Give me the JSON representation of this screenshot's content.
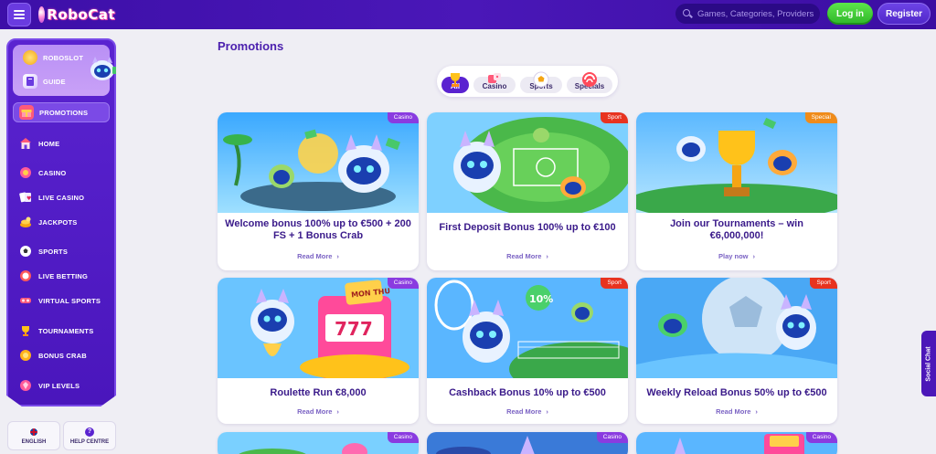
{
  "header": {
    "brand": "RoboCat",
    "search_placeholder": "Games, Categories, Providers",
    "login_label": "Log in",
    "register_label": "Register",
    "colors": {
      "header_bg": "#4a17b8",
      "login": "#3fc935",
      "register": "#5a2fd6"
    }
  },
  "sidebar": {
    "promo_items": [
      {
        "label": "ROBOSLOT",
        "icon": "coin-icon"
      },
      {
        "label": "GUIDE",
        "icon": "book-icon"
      }
    ],
    "items": [
      {
        "label": "PROMOTIONS",
        "icon": "gift-icon",
        "active": true
      },
      {
        "label": "HOME",
        "icon": "home-icon"
      },
      {
        "label": "CASINO",
        "icon": "casino-chip-icon"
      },
      {
        "label": "LIVE CASINO",
        "icon": "cards-icon"
      },
      {
        "label": "JACKPOTS",
        "icon": "jackpot-icon"
      },
      {
        "label": "SPORTS",
        "icon": "ball-icon"
      },
      {
        "label": "LIVE BETTING",
        "icon": "live-ball-icon"
      },
      {
        "label": "VIRTUAL SPORTS",
        "icon": "vr-headset-icon"
      },
      {
        "label": "TOURNAMENTS",
        "icon": "trophy-icon"
      },
      {
        "label": "BONUS CRAB",
        "icon": "crab-icon"
      },
      {
        "label": "VIP LEVELS",
        "icon": "vip-gem-icon"
      }
    ],
    "language_label": "ENGLISH",
    "help_label": "HELP CENTRE"
  },
  "main": {
    "title": "Promotions",
    "filters": [
      {
        "label": "All",
        "active": true,
        "icon": "trophy-icon"
      },
      {
        "label": "Casino",
        "icon": "dice-icon"
      },
      {
        "label": "Sports",
        "icon": "soccer-ball-icon"
      },
      {
        "label": "Specials",
        "icon": "special-icon"
      }
    ],
    "cards": [
      {
        "tag": "Casino",
        "title": "Welcome bonus 100% up to €500 + 200 FS + 1 Bonus Crab",
        "link": "Read More"
      },
      {
        "tag": "Sport",
        "title": "First Deposit Bonus 100% up to €100",
        "link": "Read More"
      },
      {
        "tag": "Special",
        "title": "Join our Tournaments – win €6,000,000!",
        "link": "Play now"
      },
      {
        "tag": "Casino",
        "title": "Roulette Run €8,000",
        "link": "Read More"
      },
      {
        "tag": "Sport",
        "title": "Cashback Bonus 10% up to €500",
        "link": "Read More"
      },
      {
        "tag": "Sport",
        "title": "Weekly Reload Bonus 50% up to €500",
        "link": "Read More"
      },
      {
        "tag": "Casino"
      },
      {
        "tag": "Casino"
      },
      {
        "tag": "Casino"
      }
    ],
    "art_text": {
      "mon_thu": "MON THU",
      "reels": "777",
      "cashback_pct": "10%"
    }
  },
  "social_chat_label": "Social Chat"
}
